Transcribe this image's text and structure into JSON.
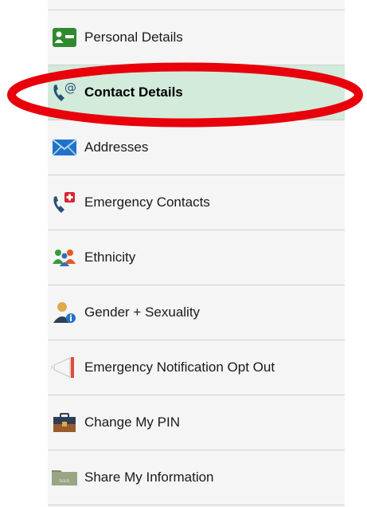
{
  "menu": {
    "items": [
      {
        "label": "Personal Details",
        "icon": "id-card-icon",
        "active": false
      },
      {
        "label": "Contact Details",
        "icon": "phone-at-icon",
        "active": true
      },
      {
        "label": "Addresses",
        "icon": "envelope-icon",
        "active": false
      },
      {
        "label": "Emergency Contacts",
        "icon": "phone-medical-icon",
        "active": false
      },
      {
        "label": "Ethnicity",
        "icon": "people-icon",
        "active": false
      },
      {
        "label": "Gender + Sexuality",
        "icon": "person-info-icon",
        "active": false
      },
      {
        "label": "Emergency Notification Opt Out",
        "icon": "megaphone-icon",
        "active": false
      },
      {
        "label": "Change My PIN",
        "icon": "briefcase-icon",
        "active": false
      },
      {
        "label": "Share My Information",
        "icon": "folder-icon",
        "active": false
      }
    ]
  },
  "colors": {
    "active_bg": "#d2ebdb",
    "panel_bg": "#f5f5f5",
    "highlight_ring": "#e8000b"
  }
}
